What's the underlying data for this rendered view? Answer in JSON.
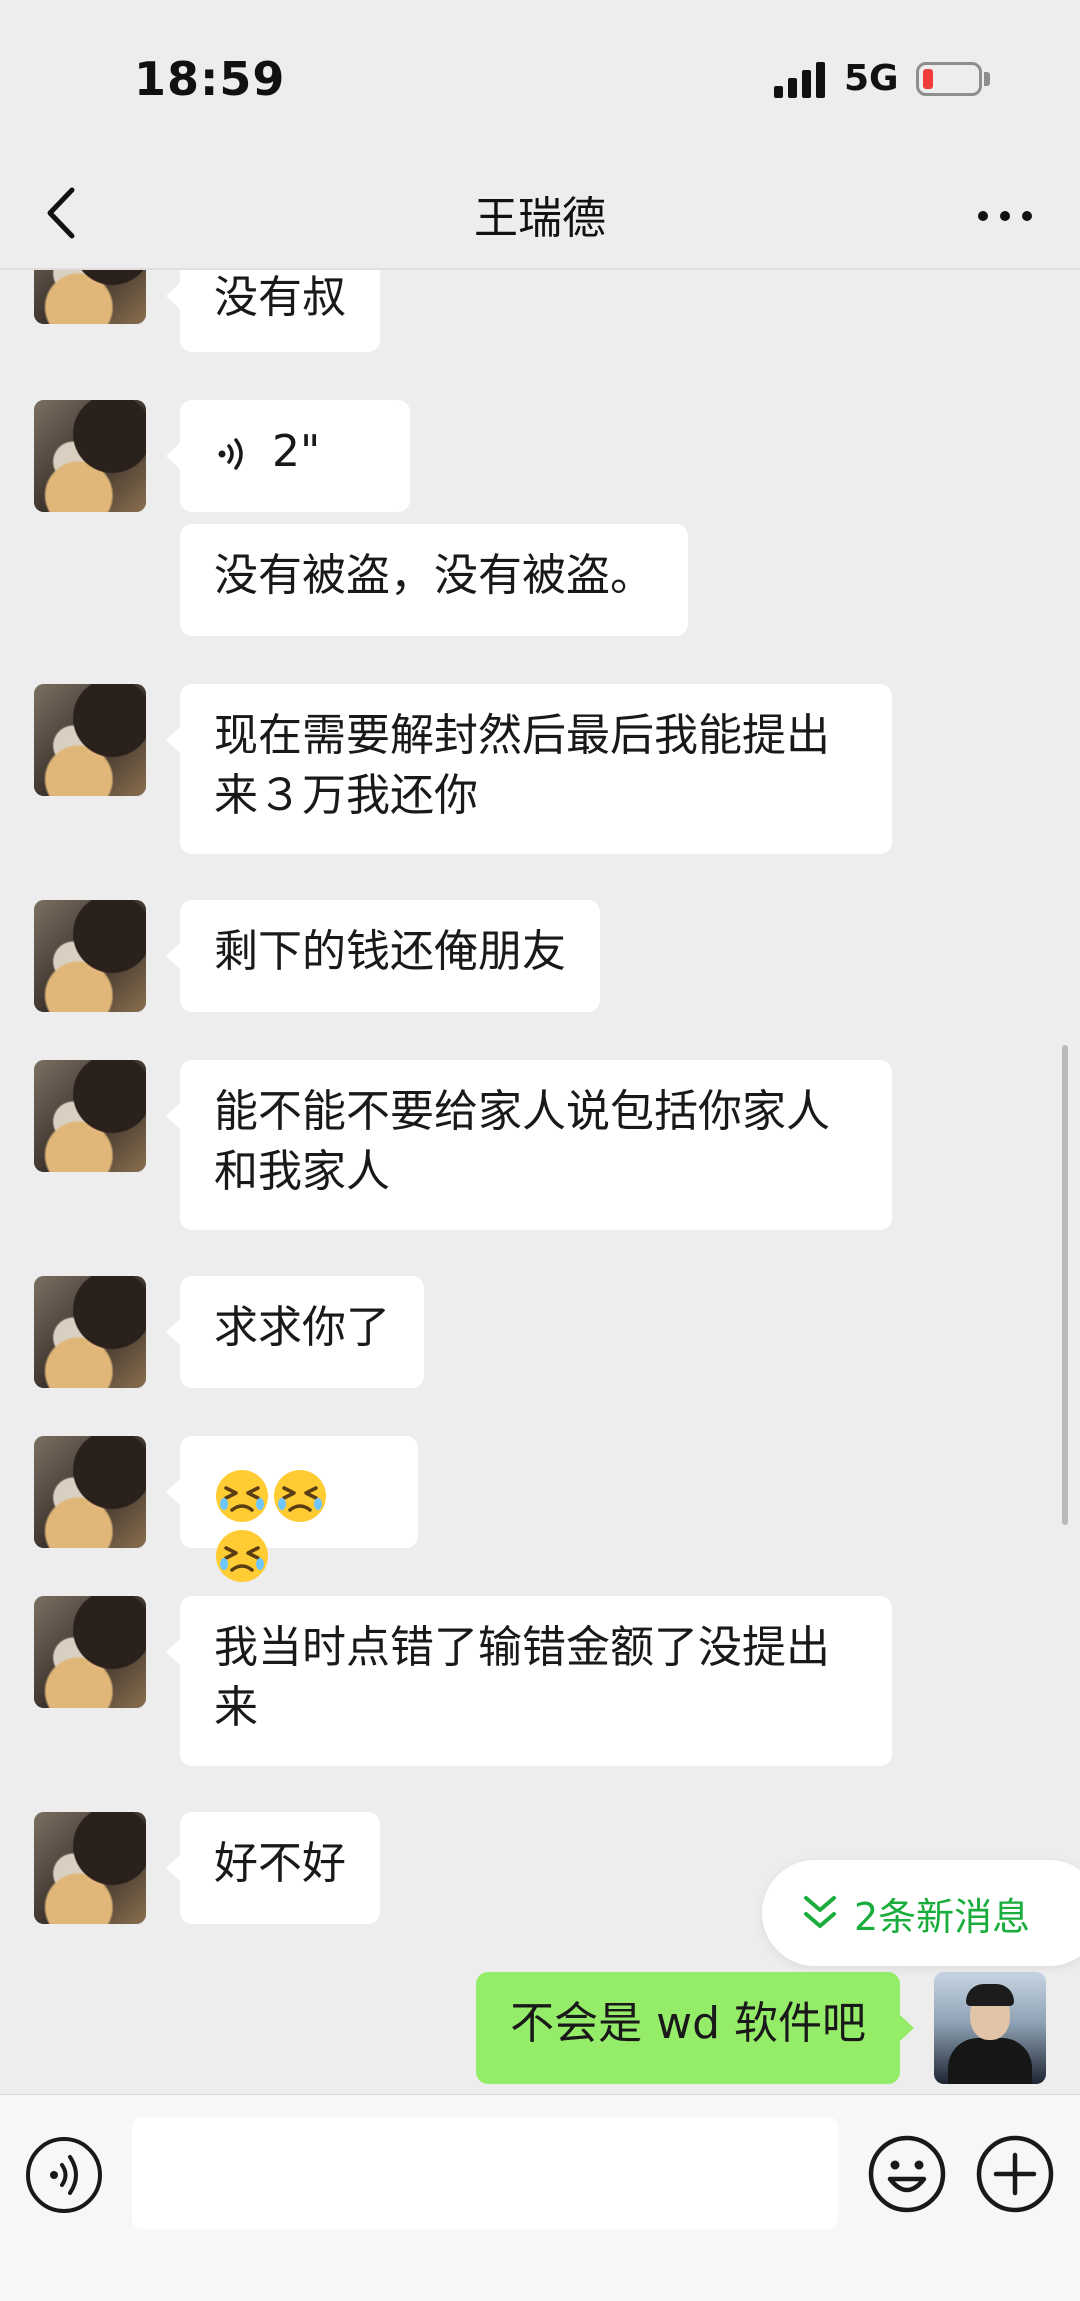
{
  "status_bar": {
    "time": "18:59",
    "network": "5G"
  },
  "header": {
    "title": "王瑞德"
  },
  "messages": [
    {
      "sender": "other",
      "text": "没有叔"
    },
    {
      "sender": "other",
      "type": "voice",
      "duration": "2\""
    },
    {
      "sender": "other",
      "text": "没有被盗，没有被盗。"
    },
    {
      "sender": "other",
      "text": "现在需要解封然后最后我能提出来３万我还你"
    },
    {
      "sender": "other",
      "text": "剩下的钱还俺朋友"
    },
    {
      "sender": "other",
      "text": "能不能不要给家人说包括你家人和我家人"
    },
    {
      "sender": "other",
      "text": "求求你了"
    },
    {
      "sender": "other",
      "type": "emoji",
      "emojis": [
        "persevering-face",
        "persevering-face",
        "persevering-face"
      ]
    },
    {
      "sender": "other",
      "text": "我当时点错了输错金额了没提出来"
    },
    {
      "sender": "other",
      "text": "好不好"
    },
    {
      "sender": "me",
      "text": "不会是 wd 软件吧"
    }
  ],
  "new_messages_pill": {
    "label": "2条新消息"
  },
  "input_bar": {
    "value": ""
  },
  "colors": {
    "background": "#ededed",
    "bubble_other": "#ffffff",
    "bubble_me": "#95ec69",
    "accent_green": "#1aad3c"
  },
  "icons": {
    "back": "chevron-left-icon",
    "more": "more-dots-icon",
    "voice_message": "voice-wave-icon",
    "voice_toggle": "voice-input-icon",
    "emoji": "smiley-icon",
    "plus": "plus-circle-icon",
    "new_messages": "double-chevron-down-icon"
  }
}
